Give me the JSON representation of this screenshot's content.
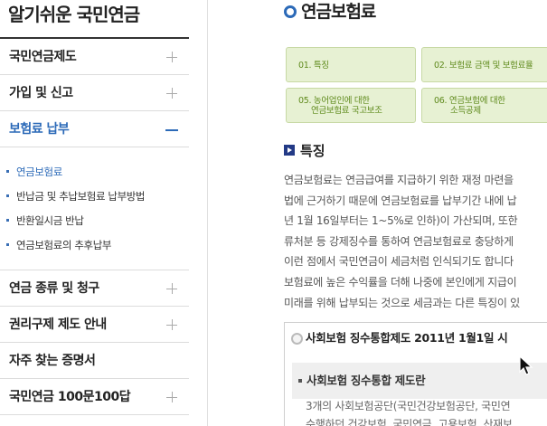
{
  "sidebar": {
    "title": "알기쉬운 국민연금",
    "items": [
      {
        "label": "국민연금제도"
      },
      {
        "label": "가입 및 신고"
      },
      {
        "label": "보험료 납부"
      },
      {
        "label": "연금 종류 및 청구"
      },
      {
        "label": "권리구제 제도 안내"
      },
      {
        "label": "자주 찾는 증명서"
      },
      {
        "label": "국민연금 100문100답"
      }
    ],
    "submenu": [
      {
        "label": "연금보험료"
      },
      {
        "label": "반납금 및 추납보험료 납부방법"
      },
      {
        "label": "반환일시금 반납"
      },
      {
        "label": "연금보험료의 추후납부"
      }
    ]
  },
  "main": {
    "page_title": "연금보험료",
    "tabs": [
      {
        "line1": "01. 특징",
        "line2": ""
      },
      {
        "line1": "02. 보험료 금액 및 보험료율",
        "line2": ""
      },
      {
        "line1": "05. 농어업인에 대한",
        "line2": "연금보험료 국고보조"
      },
      {
        "line1": "06. 연금보험에 대한",
        "line2": "소득공제"
      }
    ],
    "section_title": "특징",
    "body_lines": [
      "연금보험료는 연금급여를 지급하기 위한 재정 마련을",
      "법에 근거하기 때문에 연금보험료를 납부기간 내에 납",
      "년 1월 16일부터는 1~5%로 인하)이 가산되며, 또한",
      "류처분 등 강제징수를 통하여 연금보험료로 충당하게",
      "이런 점에서 국민연금이 세금처럼 인식되기도 합니다",
      "보험료에 높은 수익률을 더해 나중에 본인에게 지급이",
      "미래를 위해 납부되는 것으로 세금과는 다른 특징이 있"
    ],
    "info_box": {
      "title": "사회보험 징수통합제도 2011년 1월1일 시",
      "sub_title": "사회보험 징수통합 제도란",
      "lines": [
        "3개의 사회보험공단(국민건강보험공단, 국민연",
        "수행하던 건강보험, 국민연금, 고용보험, 산재보"
      ]
    }
  },
  "colors": {
    "accent_blue": "#2c6ab8",
    "tab_green_bg": "#e7f1d3",
    "tab_green_text": "#5f8a1c",
    "section_icon_navy": "#233a86"
  }
}
